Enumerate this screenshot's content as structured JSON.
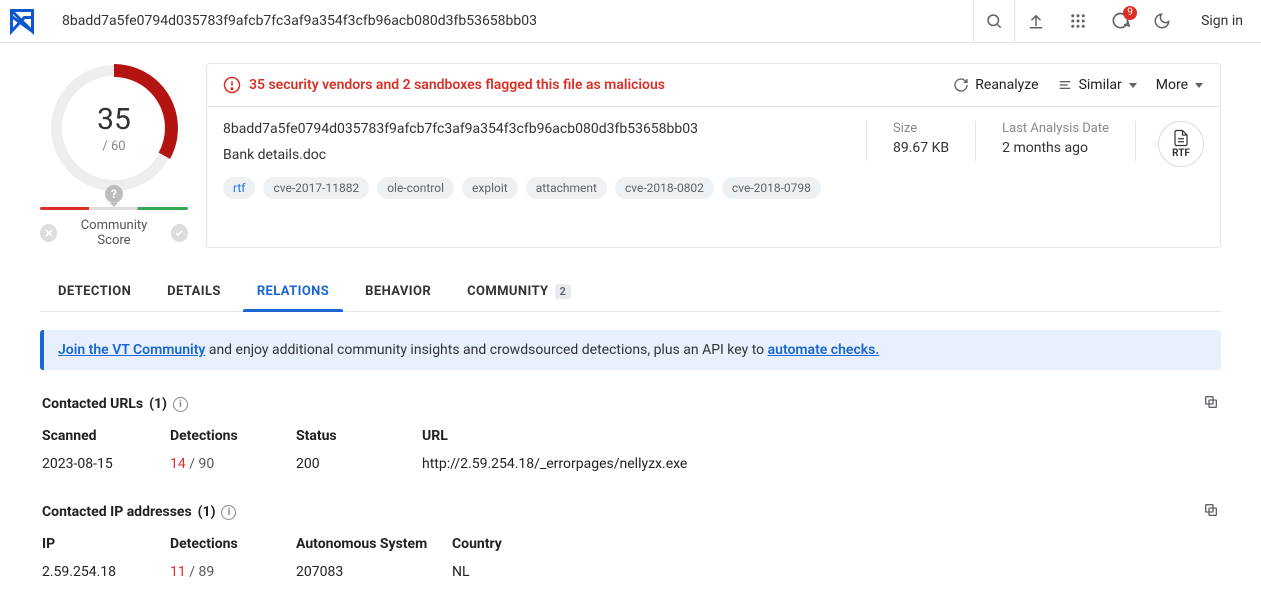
{
  "header": {
    "hash": "8badd7a5fe0794d035783f9afcb7fc3af9a354f3cfb96acb080d3fb53658bb03",
    "notif_count": "9",
    "signin": "Sign in"
  },
  "score": {
    "value": "35",
    "total": "/ 60",
    "community_label": "Community Score"
  },
  "summary": {
    "flag_text": "35 security vendors and 2 sandboxes flagged this file as malicious",
    "actions": {
      "reanalyze": "Reanalyze",
      "similar": "Similar",
      "more": "More"
    },
    "hash_full": "8badd7a5fe0794d035783f9afcb7fc3af9a354f3cfb96acb080d3fb53658bb03",
    "filename": "Bank details.doc",
    "tags": [
      "rtf",
      "cve-2017-11882",
      "ole-control",
      "exploit",
      "attachment",
      "cve-2018-0802",
      "cve-2018-0798"
    ],
    "size_label": "Size",
    "size_value": "89.67 KB",
    "date_label": "Last Analysis Date",
    "date_value": "2 months ago",
    "filetype": "RTF"
  },
  "tabs": {
    "detection": "DETECTION",
    "details": "DETAILS",
    "relations": "RELATIONS",
    "behavior": "BEHAVIOR",
    "community": "COMMUNITY",
    "community_count": "2"
  },
  "banner": {
    "join_link": "Join the VT Community",
    "middle": " and enjoy additional community insights and crowdsourced detections, plus an API key to ",
    "automate_link": "automate checks."
  },
  "urls": {
    "title": "Contacted URLs",
    "count": "(1)",
    "headers": {
      "scanned": "Scanned",
      "detections": "Detections",
      "status": "Status",
      "url": "URL"
    },
    "row": {
      "scanned": "2023-08-15",
      "det_num": "14",
      "det_total": " / 90",
      "status": "200",
      "url": "http://2.59.254.18/_errorpages/nellyzx.exe"
    }
  },
  "ips": {
    "title": "Contacted IP addresses",
    "count": "(1)",
    "headers": {
      "ip": "IP",
      "detections": "Detections",
      "as": "Autonomous System",
      "country": "Country"
    },
    "row": {
      "ip": "2.59.254.18",
      "det_num": "11",
      "det_total": " / 89",
      "as": "207083",
      "country": "NL"
    }
  }
}
